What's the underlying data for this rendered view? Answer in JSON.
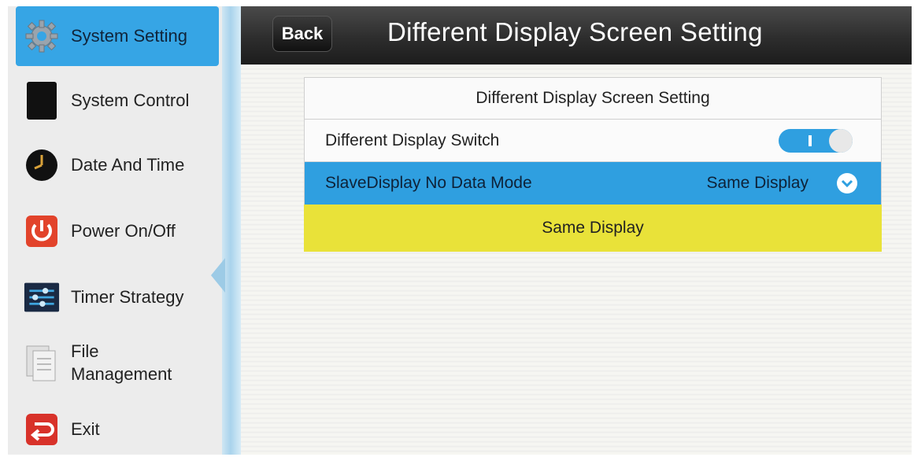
{
  "sidebar": {
    "items": [
      {
        "label": "System Setting",
        "icon": "gear-icon",
        "active": true
      },
      {
        "label": "System Control",
        "icon": "tablet-icon"
      },
      {
        "label": "Date And Time",
        "icon": "clock-icon"
      },
      {
        "label": "Power On/Off",
        "icon": "power-icon"
      },
      {
        "label": "Timer Strategy",
        "icon": "sliders-icon"
      },
      {
        "label": "File\nManagement",
        "icon": "file-icon"
      },
      {
        "label": "Exit",
        "icon": "exit-icon"
      }
    ]
  },
  "header": {
    "back_label": "Back",
    "title": "Different Display Screen Setting"
  },
  "panel": {
    "title": "Different Display Screen Setting",
    "switch_label": "Different Display Switch",
    "switch_on": true,
    "mode_label": "SlaveDisplay No Data Mode",
    "mode_value": "Same Display",
    "options": [
      "Same Display"
    ]
  },
  "colors": {
    "accent_blue": "#2f9fe0",
    "option_yellow": "#e9e239",
    "topbar_dark": "#2d2d2d"
  }
}
